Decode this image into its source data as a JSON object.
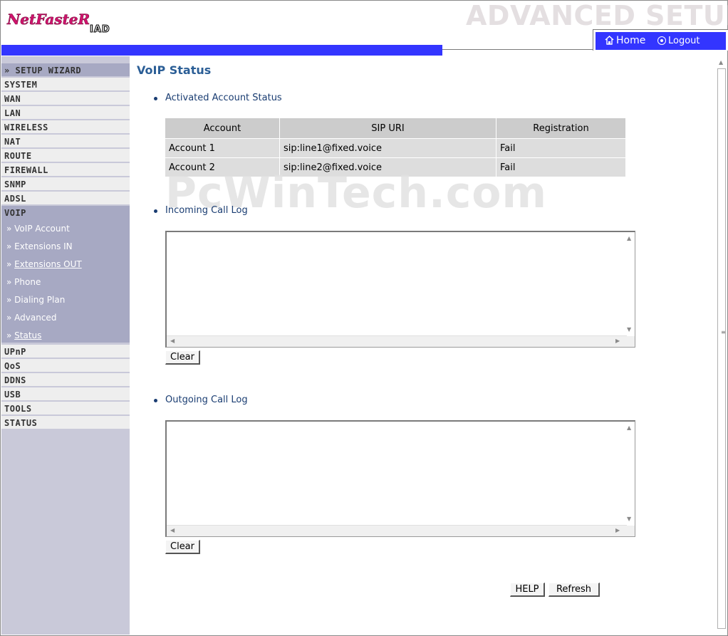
{
  "header": {
    "logo_text": "NETFASTER IAD",
    "title": "ADVANCED SETUP",
    "home_label": "Home",
    "logout_label": "Logout"
  },
  "sidebar": {
    "items": [
      {
        "label": "» SETUP WIZARD"
      },
      {
        "label": "SYSTEM"
      },
      {
        "label": "WAN"
      },
      {
        "label": "LAN"
      },
      {
        "label": "WIRELESS"
      },
      {
        "label": "NAT"
      },
      {
        "label": "ROUTE"
      },
      {
        "label": "FIREWALL"
      },
      {
        "label": "SNMP"
      },
      {
        "label": "ADSL"
      },
      {
        "label": "VOIP"
      }
    ],
    "voip_sub": [
      {
        "label": "VoIP Account"
      },
      {
        "label": "Extensions IN"
      },
      {
        "label": "Extensions OUT"
      },
      {
        "label": "Phone"
      },
      {
        "label": "Dialing Plan"
      },
      {
        "label": "Advanced"
      },
      {
        "label": "Status"
      }
    ],
    "items_after": [
      {
        "label": "UPnP"
      },
      {
        "label": "QoS"
      },
      {
        "label": "DDNS"
      },
      {
        "label": "USB"
      },
      {
        "label": "TOOLS"
      },
      {
        "label": "STATUS"
      }
    ]
  },
  "main": {
    "title": "VoIP Status",
    "activated_label": "Activated Account Status",
    "table": {
      "headers": [
        "Account",
        "SIP URI",
        "Registration"
      ],
      "rows": [
        [
          "Account 1",
          "sip:line1@fixed.voice",
          "Fail"
        ],
        [
          "Account 2",
          "sip:line2@fixed.voice",
          "Fail"
        ]
      ]
    },
    "watermark": "PcWinTech.com",
    "incoming_label": "Incoming Call Log",
    "incoming_value": "",
    "outgoing_label": "Outgoing Call Log",
    "outgoing_value": "",
    "clear_label": "Clear",
    "help_label": "HELP",
    "refresh_label": "Refresh"
  },
  "colors": {
    "accent_blue": "#3335ff",
    "title_blue": "#2b5e96",
    "sidebar_bg": "#c9c9d9",
    "sidebar_active": "#a7a9c3",
    "logo_magenta": "#d1136e"
  }
}
